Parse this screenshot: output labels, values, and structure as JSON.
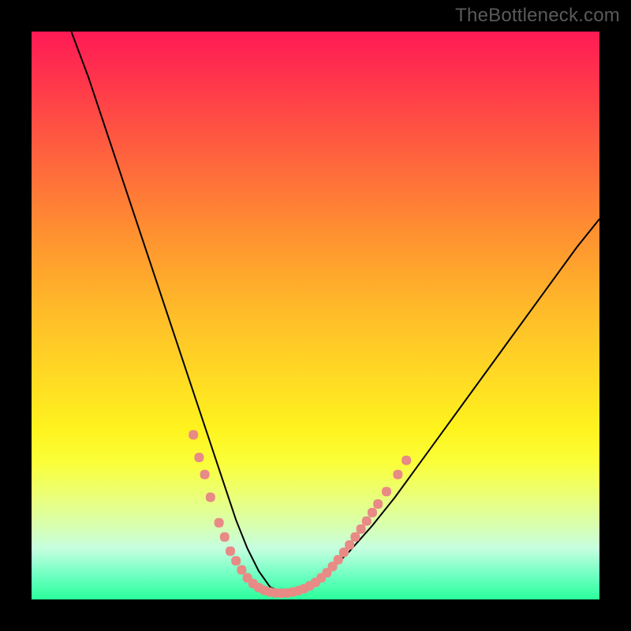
{
  "watermark": "TheBottleneck.com",
  "colors": {
    "frame": "#000000",
    "gradient_top": "#ff1a55",
    "gradient_bottom": "#2aff9a",
    "curve_stroke": "#000000",
    "dot_fill": "#e88a85"
  },
  "chart_data": {
    "type": "line",
    "title": "",
    "xlabel": "",
    "ylabel": "",
    "xlim": [
      0,
      100
    ],
    "ylim": [
      0,
      100
    ],
    "grid": false,
    "legend": false,
    "series": [
      {
        "name": "curve",
        "x": [
          7,
          10,
          12,
          14,
          16,
          18,
          20,
          22,
          24,
          26,
          28,
          30,
          32,
          34,
          36,
          38,
          40,
          42,
          44,
          48,
          52,
          56,
          60,
          64,
          68,
          72,
          76,
          80,
          84,
          88,
          92,
          96,
          100
        ],
        "y": [
          100,
          92,
          86,
          80,
          74,
          68,
          62,
          56,
          50,
          44,
          38,
          32,
          26,
          20,
          14,
          9,
          5,
          2.2,
          1.2,
          1.8,
          4.5,
          8.5,
          13,
          18,
          23.5,
          29,
          34.5,
          40,
          45.5,
          51,
          56.5,
          62,
          67
        ]
      }
    ],
    "markers": {
      "name": "dots",
      "shape": "rounded-rect",
      "color": "#e88a85",
      "points": [
        {
          "x": 28.5,
          "y": 29
        },
        {
          "x": 29.5,
          "y": 25
        },
        {
          "x": 30.5,
          "y": 22
        },
        {
          "x": 31.5,
          "y": 18
        },
        {
          "x": 33.0,
          "y": 13.5
        },
        {
          "x": 34.0,
          "y": 11
        },
        {
          "x": 35.0,
          "y": 8.5
        },
        {
          "x": 36.0,
          "y": 6.8
        },
        {
          "x": 37.0,
          "y": 5.2
        },
        {
          "x": 38.0,
          "y": 3.8
        },
        {
          "x": 39.0,
          "y": 2.8
        },
        {
          "x": 40.0,
          "y": 2.1
        },
        {
          "x": 41.0,
          "y": 1.6
        },
        {
          "x": 42.0,
          "y": 1.3
        },
        {
          "x": 43.0,
          "y": 1.15
        },
        {
          "x": 44.0,
          "y": 1.1
        },
        {
          "x": 45.0,
          "y": 1.15
        },
        {
          "x": 46.0,
          "y": 1.3
        },
        {
          "x": 47.0,
          "y": 1.55
        },
        {
          "x": 48.0,
          "y": 1.9
        },
        {
          "x": 49.0,
          "y": 2.4
        },
        {
          "x": 50.0,
          "y": 3.0
        },
        {
          "x": 51.0,
          "y": 3.8
        },
        {
          "x": 52.0,
          "y": 4.7
        },
        {
          "x": 53.0,
          "y": 5.8
        },
        {
          "x": 54.0,
          "y": 7.0
        },
        {
          "x": 55.0,
          "y": 8.3
        },
        {
          "x": 56.0,
          "y": 9.6
        },
        {
          "x": 57.0,
          "y": 11.0
        },
        {
          "x": 58.0,
          "y": 12.4
        },
        {
          "x": 59.0,
          "y": 13.8
        },
        {
          "x": 60.0,
          "y": 15.3
        },
        {
          "x": 61.0,
          "y": 16.8
        },
        {
          "x": 62.5,
          "y": 19.0
        },
        {
          "x": 64.5,
          "y": 22.0
        },
        {
          "x": 66.0,
          "y": 24.5
        }
      ]
    }
  }
}
